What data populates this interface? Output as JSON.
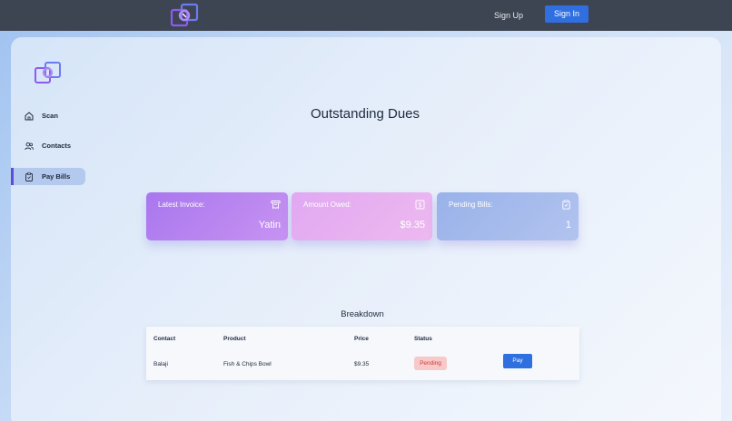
{
  "topbar": {
    "logo_icon": "overlapping-squares-logo-icon",
    "signup_label": "Sign Up",
    "signin_label": "Sign In",
    "colors": {
      "bar": "#3d4452",
      "primary": "#2f6fe0"
    }
  },
  "sidebar": {
    "logo_icon": "overlapping-squares-logo-icon",
    "items": [
      {
        "label": "Scan",
        "icon": "home-icon",
        "active": false
      },
      {
        "label": "Contacts",
        "icon": "users-icon",
        "active": false
      },
      {
        "label": "Pay Bills",
        "icon": "clipboard-icon",
        "active": true
      }
    ]
  },
  "main": {
    "title": "Outstanding Dues",
    "cards": [
      {
        "label": "Latest Invoice:",
        "value": "Yatin",
        "icon": "receipt-icon"
      },
      {
        "label": "Amount Owed:",
        "value": "$9.35",
        "icon": "dollar-icon"
      },
      {
        "label": "Pending Bills:",
        "value": "1",
        "icon": "clipboard-icon"
      }
    ],
    "breakdown": {
      "title": "Breakdown",
      "columns": [
        "Contact",
        "Product",
        "Price",
        "Status"
      ],
      "rows": [
        {
          "contact": "Balaji",
          "product": "Fish & Chips Bowl",
          "price": "$9.35",
          "status": "Pending",
          "action": "Pay"
        }
      ]
    }
  }
}
